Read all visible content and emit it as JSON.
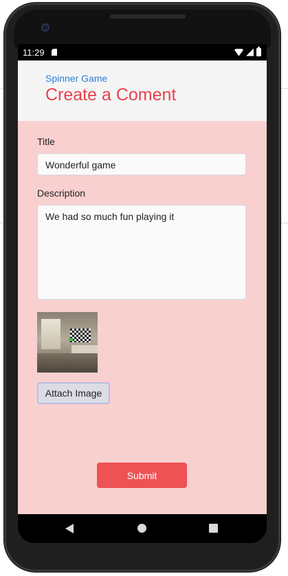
{
  "status_bar": {
    "time": "11:29"
  },
  "header": {
    "subtitle": "Spinner Game",
    "title": "Create a Coment"
  },
  "form": {
    "title_label": "Title",
    "title_value": "Wonderful game",
    "description_label": "Description",
    "description_value": "We had so much fun playing it",
    "attach_label": "Attach Image",
    "submit_label": "Submit"
  },
  "icons": {
    "status": [
      "sd-card-icon",
      "wifi-icon",
      "signal-icon",
      "battery-icon"
    ],
    "nav": [
      "back-icon",
      "home-icon",
      "recent-apps-icon"
    ]
  },
  "colors": {
    "accent": "#e8424c",
    "link": "#2b7fd3",
    "content_bg": "#f9d0d0",
    "submit_bg": "#ee5254"
  }
}
